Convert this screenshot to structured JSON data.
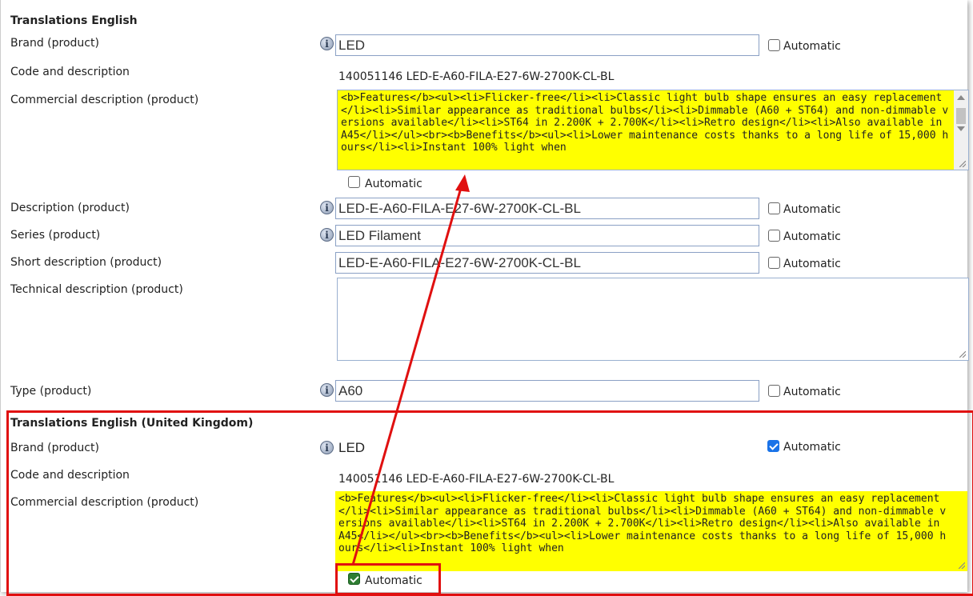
{
  "section1": {
    "title": "Translations English",
    "brand": {
      "label": "Brand (product)",
      "value": "LED",
      "auto": "Automatic"
    },
    "code": {
      "label": "Code and description",
      "value": "140051146 LED-E-A60-FILA-E27-6W-2700K-CL-BL"
    },
    "commercial": {
      "label": "Commercial description (product)",
      "value": "<b>Features</b><ul><li>Flicker-free</li><li>Classic light bulb shape ensures an easy replacement</li><li>Similar appearance as traditional bulbs</li><li>Dimmable (A60 + ST64) and non-dimmable versions available</li><li>ST64 in 2.200K + 2.700K</li><li>Retro design</li><li>Also available in A45</li></ul><br><b>Benefits</b><ul><li>Lower maintenance costs thanks to a long life of 15,000 hours</li><li>Instant 100% light when",
      "auto": "Automatic"
    },
    "description": {
      "label": "Description (product)",
      "value": "LED-E-A60-FILA-E27-6W-2700K-CL-BL",
      "auto": "Automatic"
    },
    "series": {
      "label": "Series (product)",
      "value": "LED Filament",
      "auto": "Automatic"
    },
    "short": {
      "label": "Short description (product)",
      "value": "LED-E-A60-FILA-E27-6W-2700K-CL-BL",
      "auto": "Automatic"
    },
    "technical": {
      "label": "Technical description (product)"
    },
    "type": {
      "label": "Type (product)",
      "value": "A60",
      "auto": "Automatic"
    }
  },
  "section2": {
    "title": "Translations English (United Kingdom)",
    "brand": {
      "label": "Brand (product)",
      "value": "LED",
      "auto": "Automatic",
      "checked": true
    },
    "code": {
      "label": "Code and description",
      "value": "140051146 LED-E-A60-FILA-E27-6W-2700K-CL-BL"
    },
    "commercial": {
      "label": "Commercial description (product)",
      "value": "<b>Features</b><ul><li>Flicker-free</li><li>Classic light bulb shape ensures an easy replacement</li><li>Similar appearance as traditional bulbs</li><li>Dimmable (A60 + ST64) and non-dimmable versions available</li><li>ST64 in 2.200K + 2.700K</li><li>Retro design</li><li>Also available in A45</li></ul><br><b>Benefits</b><ul><li>Lower maintenance costs thanks to a long life of 15,000 hours</li><li>Instant 100% light when",
      "auto": "Automatic",
      "checked": true
    }
  },
  "icons": {
    "info": "i",
    "info_name": "info-icon"
  },
  "colors": {
    "highlight": "#ffff00",
    "annotation": "#e01010",
    "checkbox_blue": "#1a73e8",
    "checkbox_green": "#2e7d32"
  }
}
